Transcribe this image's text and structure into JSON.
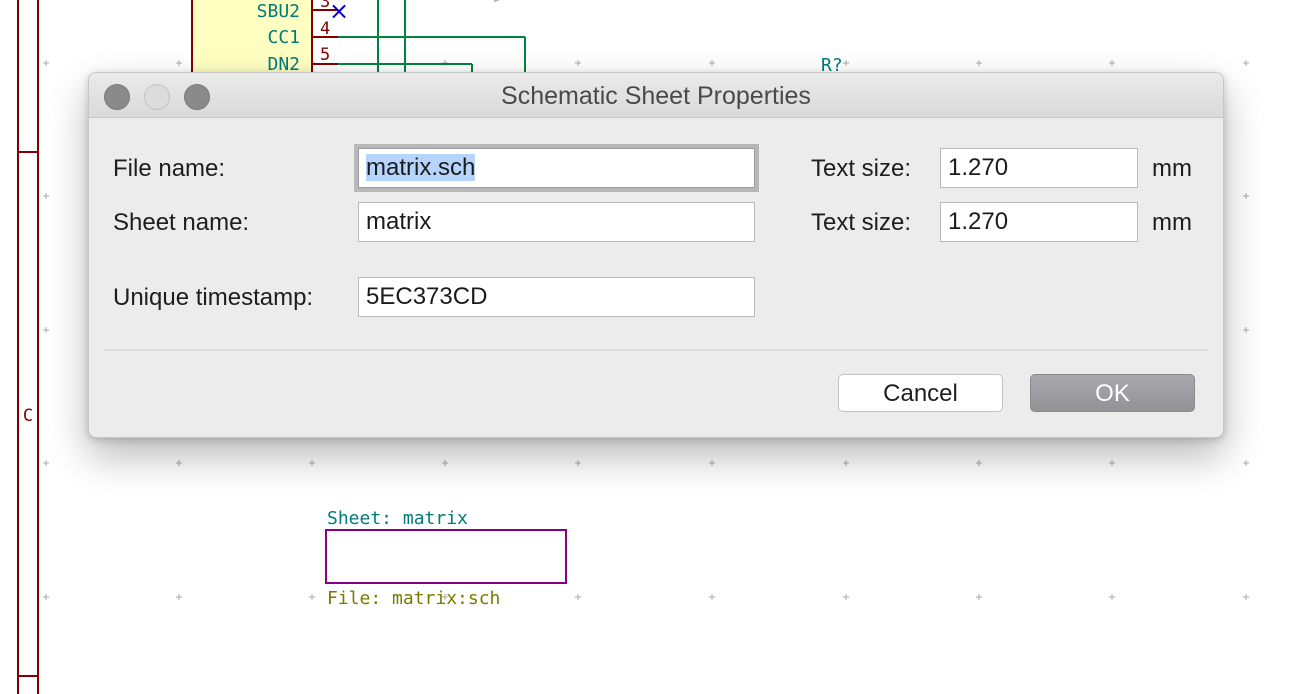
{
  "schematic": {
    "pins": [
      {
        "name": "SBU2",
        "number": "3"
      },
      {
        "name": "CC1",
        "number": "4"
      },
      {
        "name": "DN2",
        "number": "5"
      }
    ],
    "no_connect_mark": "×",
    "ref_label": "R?",
    "border_label": "C",
    "sheet": {
      "name_label": "Sheet: matrix",
      "file_label": "File: matrix:sch"
    },
    "colors": {
      "wire": "#00843d",
      "pin": "#840000",
      "label_teal": "#007b7b",
      "sheet_border": "#840084",
      "file_label": "#7a7a00",
      "component_fill": "#ffffc2",
      "frame": "#840000",
      "no_connect": "#0000c8"
    }
  },
  "dialog": {
    "title": "Schematic Sheet Properties",
    "file_name": {
      "label": "File name:",
      "value": "matrix.sch"
    },
    "sheet_name": {
      "label": "Sheet name:",
      "value": "matrix"
    },
    "timestamp": {
      "label": "Unique timestamp:",
      "value": "5EC373CD"
    },
    "file_text_size": {
      "label": "Text size:",
      "value": "1.270",
      "unit": "mm"
    },
    "sheet_text_size": {
      "label": "Text size:",
      "value": "1.270",
      "unit": "mm"
    },
    "cancel_label": "Cancel",
    "ok_label": "OK"
  }
}
